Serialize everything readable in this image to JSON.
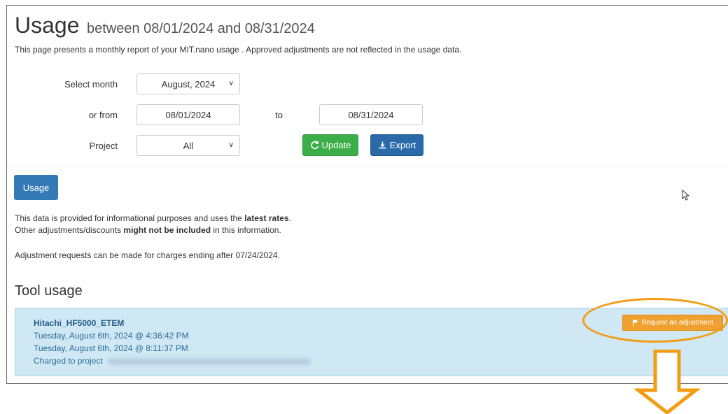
{
  "header": {
    "title": "Usage",
    "subtitle": "between 08/01/2024 and 08/31/2024",
    "description": "This page presents a monthly report of your MIT.nano usage . Approved adjustments are not reflected in the usage data."
  },
  "form": {
    "month_label": "Select month",
    "month_value": "August, 2024",
    "from_label": "or from",
    "from_value": "08/01/2024",
    "to_label": "to",
    "to_value": "08/31/2024",
    "project_label": "Project",
    "project_value": "All",
    "update_label": "Update",
    "export_label": "Export"
  },
  "tabs": {
    "usage_label": "Usage"
  },
  "info": {
    "line1_pre": "This data is provided for informational purposes and uses the ",
    "line1_bold": "latest rates",
    "line1_post": ".",
    "line2_pre": "Other adjustments/discounts ",
    "line2_bold": "might not be included",
    "line2_post": " in this information.",
    "line3": "Adjustment requests can be made for charges ending after 07/24/2024."
  },
  "tool_usage": {
    "heading": "Tool usage",
    "items": [
      {
        "tool": "Hitachi_HF5000_ETEM",
        "start": "Tuesday, August 6th, 2024 @ 4:36:42 PM",
        "end": "Tuesday, August 6th, 2024 @ 8:11:37 PM",
        "charged_label": "Charged to project",
        "adjust_label": "Request an adjustment"
      }
    ]
  },
  "annotation": {
    "color": "#f39c12"
  }
}
